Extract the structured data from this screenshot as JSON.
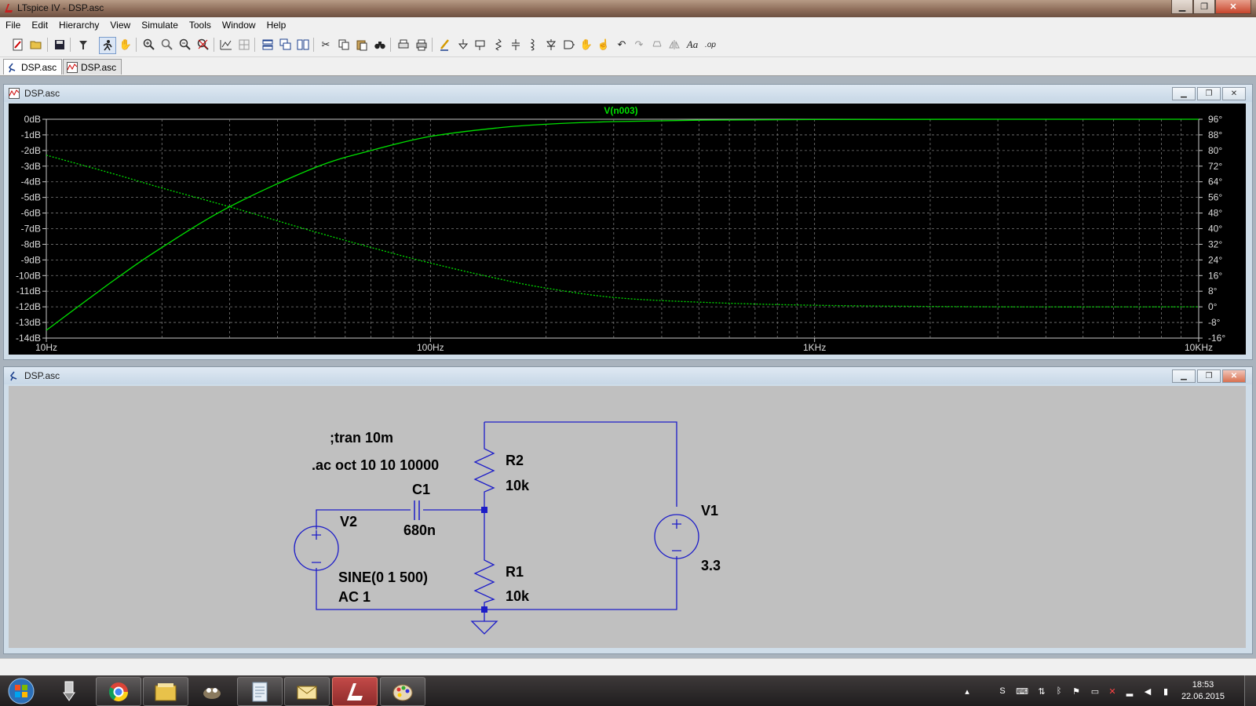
{
  "window": {
    "title": "LTspice IV - DSP.asc",
    "controls": {
      "minimize": "▁",
      "maximize": "❐",
      "close": "✕"
    }
  },
  "menu": [
    "File",
    "Edit",
    "Hierarchy",
    "View",
    "Simulate",
    "Tools",
    "Window",
    "Help"
  ],
  "toolbar": {
    "buttons": [
      "new-schematic-icon",
      "open-icon",
      "save-icon",
      "control-panel-icon",
      "run-icon",
      "pan-icon",
      "zoom-in-icon",
      "zoom-area-icon",
      "zoom-out-icon",
      "zoom-fit-icon",
      "autoscale-icon",
      "grid-icon",
      "tile-horizontal-icon",
      "cascade-icon",
      "tile-vertical-icon",
      "cut-icon",
      "copy-icon",
      "paste-icon",
      "find-icon",
      "print-preview-icon",
      "print-icon",
      "wire-icon",
      "ground-icon",
      "label-icon",
      "resistor-icon",
      "capacitor-icon",
      "inductor-icon",
      "diode-icon",
      "component-icon",
      "move-icon",
      "drag-icon",
      "undo-icon",
      "redo-icon",
      "rotate-icon",
      "mirror-icon",
      "text-icon",
      "spice-directive-icon"
    ],
    "text_glyphs": {
      "text_tool": "Aa",
      "directive_tool": ".op"
    }
  },
  "tabs": [
    {
      "label": "DSP.asc",
      "kind": "schematic",
      "active": true
    },
    {
      "label": "DSP.asc",
      "kind": "waveform",
      "active": false
    }
  ],
  "plot_window": {
    "title": "DSP.asc",
    "trace_label": "V(n003)",
    "trace_color": "#00e000"
  },
  "chart_data": {
    "type": "line",
    "title": "V(n003)",
    "x_scale": "log",
    "xlim": [
      10,
      10000
    ],
    "x_ticks": [
      "10Hz",
      "100Hz",
      "1KHz",
      "10KHz"
    ],
    "left_axis": {
      "ylim": [
        -14,
        0
      ],
      "ticks": [
        "0dB",
        "-1dB",
        "-2dB",
        "-3dB",
        "-4dB",
        "-5dB",
        "-6dB",
        "-7dB",
        "-8dB",
        "-9dB",
        "-10dB",
        "-11dB",
        "-12dB",
        "-13dB",
        "-14dB"
      ]
    },
    "right_axis": {
      "ylim": [
        -16,
        96
      ],
      "ticks": [
        "96°",
        "88°",
        "80°",
        "72°",
        "64°",
        "56°",
        "48°",
        "40°",
        "32°",
        "24°",
        "16°",
        "8°",
        "0°",
        "-8°",
        "-16°"
      ]
    },
    "grid": true,
    "series": [
      {
        "style": "solid",
        "axis": "left",
        "x": [
          10,
          15,
          20,
          30,
          50,
          70,
          100,
          150,
          200,
          300,
          500,
          1000,
          3000,
          10000
        ],
        "values": [
          -13.5,
          -10.3,
          -8.2,
          -5.6,
          -3.1,
          -2.0,
          -1.1,
          -0.55,
          -0.32,
          -0.15,
          -0.06,
          -0.02,
          0,
          0
        ]
      },
      {
        "style": "dashed",
        "axis": "left",
        "x": [
          10,
          15,
          20,
          30,
          50,
          70,
          100,
          150,
          200,
          300,
          500,
          1000,
          3000,
          10000
        ],
        "values": [
          -2.3,
          -3.5,
          -4.4,
          -5.6,
          -7.2,
          -8.2,
          -9.2,
          -10.2,
          -10.8,
          -11.4,
          -11.7,
          -11.9,
          -12.0,
          -12.0
        ]
      }
    ]
  },
  "schematic_window": {
    "title": "DSP.asc",
    "directives": [
      ";tran 10m",
      ".ac oct 10 10 10000"
    ],
    "components": {
      "C1": {
        "name": "C1",
        "value": "680n"
      },
      "R1": {
        "name": "R1",
        "value": "10k"
      },
      "R2": {
        "name": "R2",
        "value": "10k"
      },
      "V1": {
        "name": "V1",
        "value": "3.3"
      },
      "V2": {
        "name": "V2",
        "value_line1": "SINE(0 1 500)",
        "value_line2": "AC 1"
      }
    },
    "wire_color": "#1c1cc8",
    "background": "#c0c0c0"
  },
  "taskbar": {
    "apps": [
      "start-orb",
      "usb-icon",
      "chrome-icon",
      "explorer-icon",
      "gimp-icon",
      "notes-icon",
      "mail-icon",
      "ltspice-icon",
      "paint-icon"
    ],
    "clock_time": "18:53",
    "clock_date": "22.06.2015"
  }
}
